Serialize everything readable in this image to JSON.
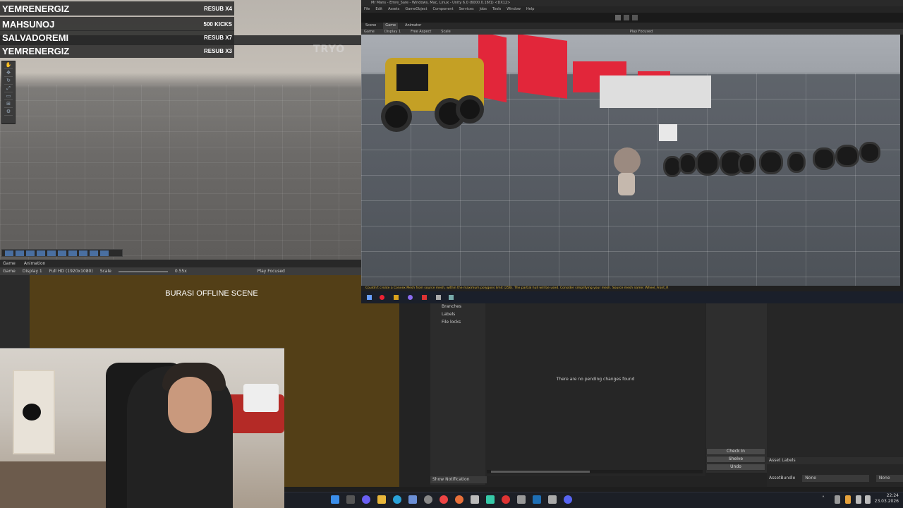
{
  "leaderboard": [
    {
      "name": "YEMRENERGIZ",
      "value": "RESUB X4"
    },
    {
      "name": "MAHSUNOJ",
      "value": "500 KICKS"
    },
    {
      "name": "SALVADOREMI",
      "value": "RESUB X7"
    },
    {
      "name": "YEMRENERGIZ",
      "value": "RESUB X3"
    }
  ],
  "left_overlay": {
    "watermark": "TRYO"
  },
  "game_panel": {
    "tabs": [
      "Game",
      "Animation"
    ],
    "bar": {
      "mode": "Game",
      "display": "Display 1",
      "resolution": "Full HD (1920x1080)",
      "scale_label": "Scale",
      "scale_value": "0.55x",
      "play": "Play Focused"
    },
    "scene_text": "BURASI OFFLINE SCENE"
  },
  "remote_window": {
    "title": "Mr Mans - Emre_Sare - Windows, Mac, Linux - Unity 6.0 (6000.0.16f1) <DX12>",
    "menu": [
      "File",
      "Edit",
      "Assets",
      "GameObject",
      "Component",
      "Services",
      "Jobs",
      "Tools",
      "Window",
      "Help"
    ],
    "tabs": [
      "Scene",
      "Game",
      "Animator"
    ],
    "bar": [
      "Game",
      "Display 1",
      "Free Aspect",
      "Scale",
      "Play Focused"
    ],
    "warning": "Couldn't create a Convex Mesh from source mesh, within the maximum polygons limit (256). The partial hull will be used. Consider simplifying your mesh. Source mesh name: Wheel_Front_R"
  },
  "version_control": {
    "sidebar": [
      "Branches",
      "Labels",
      "File locks"
    ],
    "empty_message": "There are no pending changes found",
    "buttons": [
      "Check In",
      "Shelve",
      "Undo"
    ],
    "show_notification": "Show Notification"
  },
  "asset_panel": {
    "labels_title": "Asset Labels",
    "bundle_label": "AssetBundle",
    "bundle_value": "None",
    "variant_value": "None"
  },
  "clock": {
    "time": "22:24",
    "date": "23.03.2026"
  }
}
